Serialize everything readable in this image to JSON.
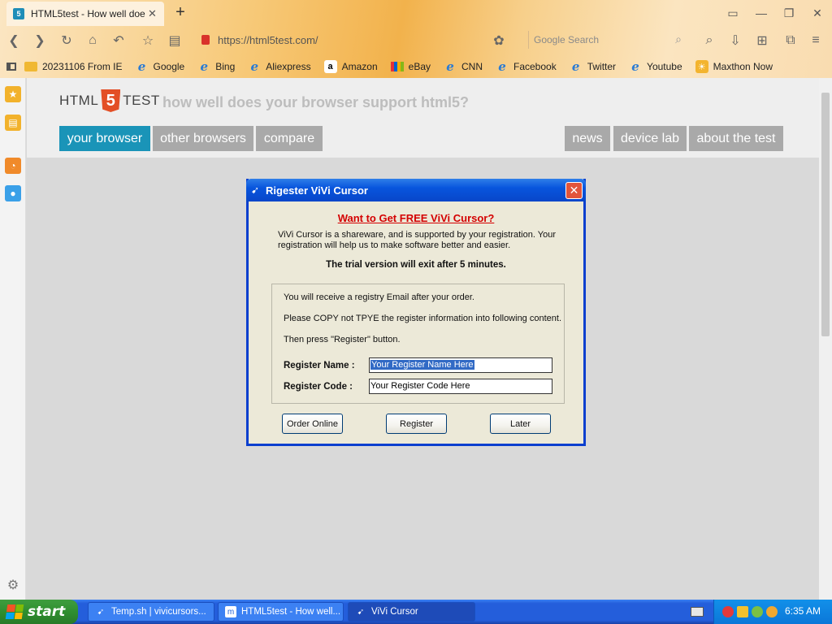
{
  "browser": {
    "tab": {
      "title": "HTML5test - How well doe",
      "favicon": "5",
      "close": "✕"
    },
    "new_tab": "+",
    "url": "https://html5test.com/",
    "search_placeholder": "Google Search",
    "bookmarks": [
      {
        "label": "20231106 From IE",
        "icon": "folder-icon"
      },
      {
        "label": "Google",
        "icon": "ie-icon"
      },
      {
        "label": "Bing",
        "icon": "ie-icon"
      },
      {
        "label": "Aliexpress",
        "icon": "ie-icon"
      },
      {
        "label": "Amazon",
        "icon": "amazon-icon"
      },
      {
        "label": "eBay",
        "icon": "ebay-icon"
      },
      {
        "label": "CNN",
        "icon": "ie-icon"
      },
      {
        "label": "Facebook",
        "icon": "ie-icon"
      },
      {
        "label": "Twitter",
        "icon": "ie-icon"
      },
      {
        "label": "Youtube",
        "icon": "ie-icon"
      },
      {
        "label": "Maxthon Now",
        "icon": "maxthon-icon"
      }
    ]
  },
  "page": {
    "logo": {
      "part1": "HTML",
      "part2": "5",
      "part3": "TEST"
    },
    "tagline": "how well does your browser support html5?",
    "nav_left": [
      "your browser",
      "other browsers",
      "compare"
    ],
    "nav_right": [
      "news",
      "device lab",
      "about the test"
    ]
  },
  "dialog": {
    "title": "Rigester ViVi Cursor",
    "close": "✕",
    "headline": "Want to Get FREE ViVi Cursor?",
    "description": "ViVi Cursor is a shareware, and is supported by your registration. Your registration will help us to make software better and easier.",
    "trial_notice": "The trial version will exit after 5 minutes.",
    "info_lines": [
      "You will receive a  registry Email after your order.",
      "Please COPY not TPYE the register information into following content.",
      "Then press \"Register\" button."
    ],
    "name_label": "Register Name :",
    "name_value": "Your Register Name Here",
    "code_label": "Register Code :",
    "code_value": "Your Register Code Here",
    "buttons": {
      "order": "Order Online",
      "register": "Register",
      "later": "Later"
    }
  },
  "taskbar": {
    "start": "start",
    "items": [
      "Temp.sh | vivicursors...",
      "HTML5test - How well...",
      "ViVi Cursor"
    ],
    "clock": "6:35 AM"
  },
  "colors": {
    "accent_tab": "#1a94b8",
    "nav_gray": "#a9a9a9",
    "xp_blue": "#245edb",
    "dialog_headline": "#d40000"
  }
}
